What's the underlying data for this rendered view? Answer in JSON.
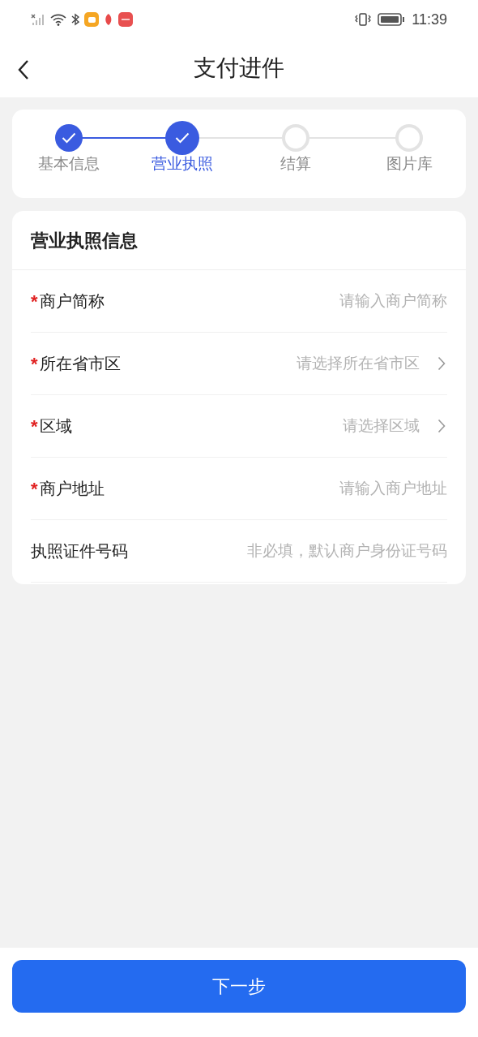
{
  "status_bar": {
    "time": "11:39"
  },
  "nav": {
    "title": "支付进件"
  },
  "steps": [
    {
      "label": "基本信息",
      "done": true,
      "selected": false
    },
    {
      "label": "营业执照",
      "done": true,
      "selected": true
    },
    {
      "label": "结算",
      "done": false,
      "selected": false
    },
    {
      "label": "图片库",
      "done": false,
      "selected": false
    }
  ],
  "form": {
    "title": "营业执照信息",
    "fields": [
      {
        "kind": "input",
        "required_mark": "*",
        "label": "商户简称",
        "placeholder": "请输入商户简称"
      },
      {
        "kind": "select",
        "required_mark": "*",
        "label": "所在省市区",
        "placeholder": "请选择所在省市区"
      },
      {
        "kind": "select",
        "required_mark": "*",
        "label": "区域",
        "placeholder": "请选择区域"
      },
      {
        "kind": "input",
        "required_mark": "*",
        "label": "商户地址",
        "placeholder": "请输入商户地址"
      },
      {
        "kind": "input",
        "label": "执照证件号码",
        "placeholder": "非必填，默认商户身份证号码"
      }
    ]
  },
  "next_button": "下一步"
}
